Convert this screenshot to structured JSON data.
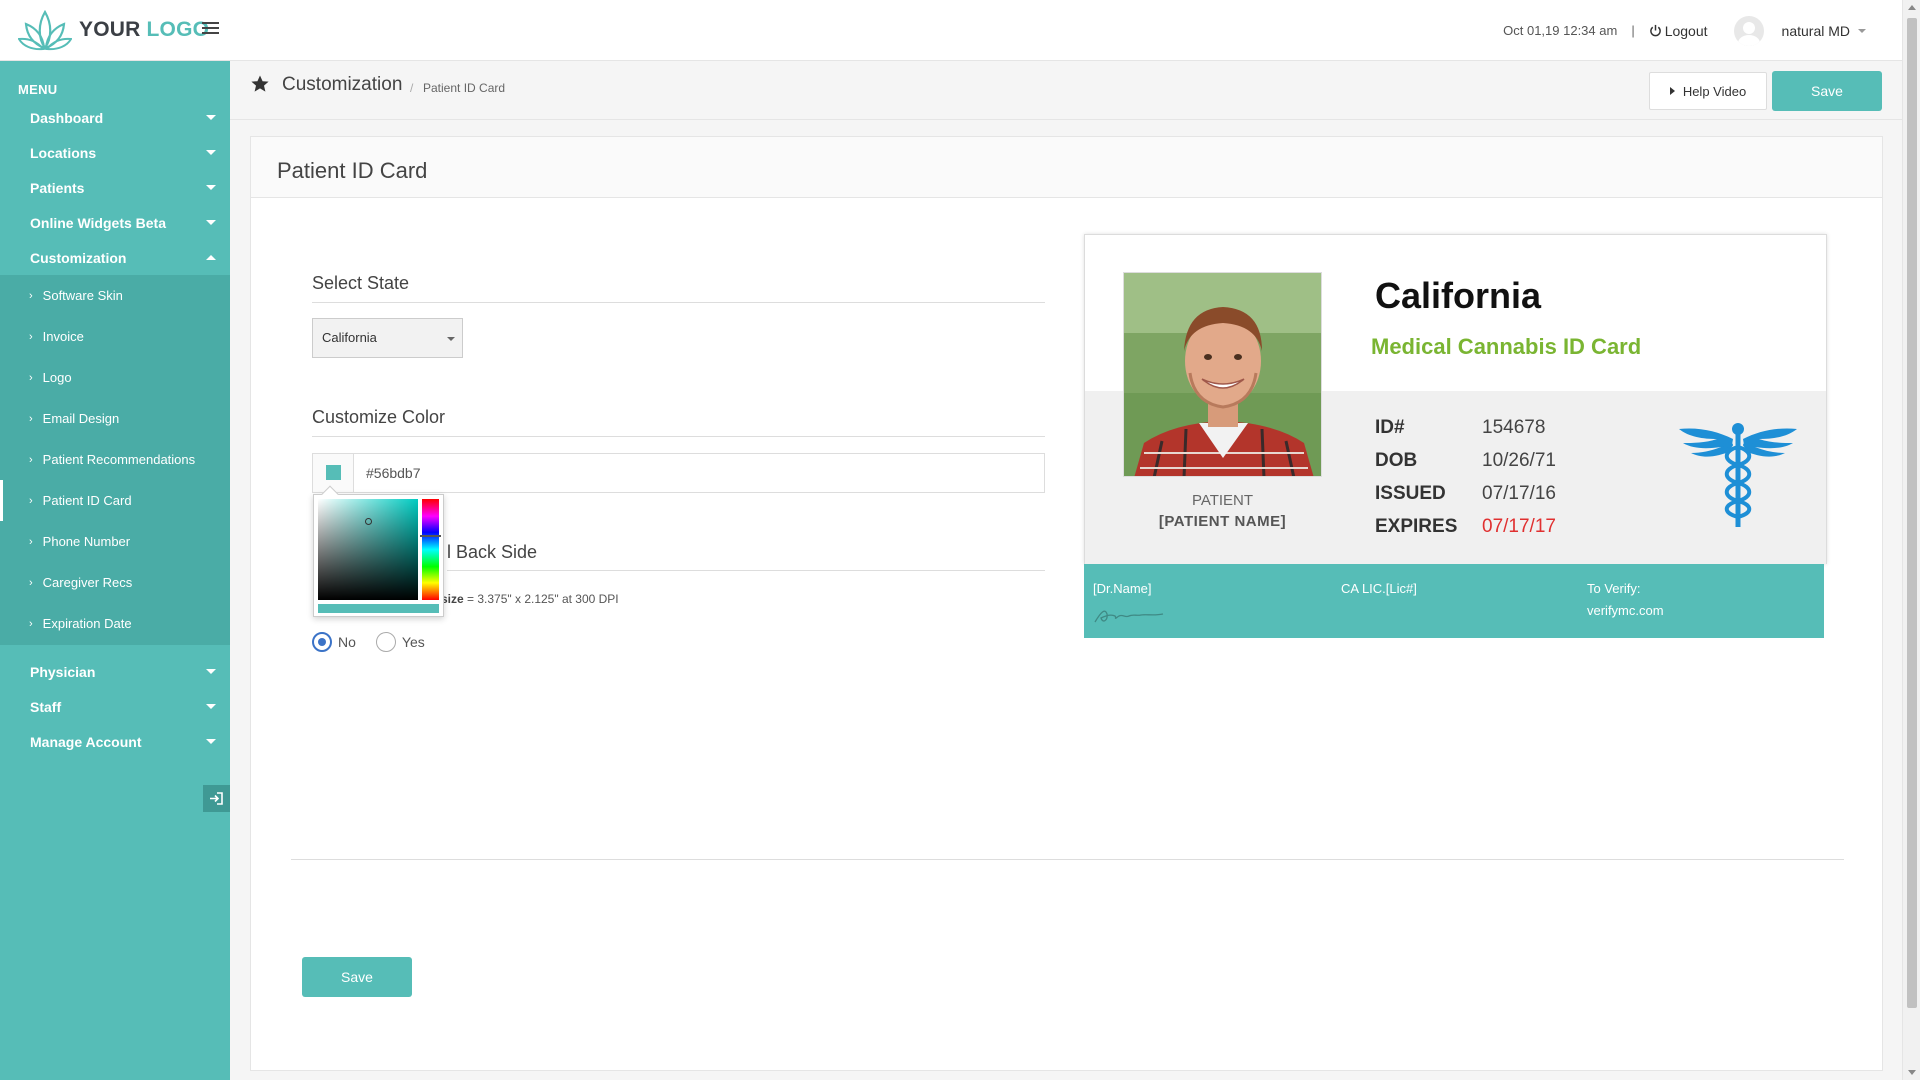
{
  "header": {
    "logo": {
      "word1": "YOUR",
      "word2": "LOGO"
    },
    "datetime": "Oct 01,19 12:34 am",
    "separator": "|",
    "logout_label": "Logout",
    "username": "natural MD"
  },
  "sidebar": {
    "menu_title": "MENU",
    "items": [
      {
        "label": "Dashboard"
      },
      {
        "label": "Locations"
      },
      {
        "label": "Patients"
      },
      {
        "label": "Online Widgets Beta"
      },
      {
        "label": "Customization",
        "expanded": true
      }
    ],
    "submenu": [
      {
        "label": "Software Skin"
      },
      {
        "label": "Invoice"
      },
      {
        "label": "Logo"
      },
      {
        "label": "Email Design"
      },
      {
        "label": "Patient Recommendations"
      },
      {
        "label": "Patient ID Card",
        "active": true
      },
      {
        "label": "Phone Number"
      },
      {
        "label": "Caregiver Recs"
      },
      {
        "label": "Expiration Date"
      }
    ],
    "items_after": [
      {
        "label": "Physician"
      },
      {
        "label": "Staff"
      },
      {
        "label": "Manage Account"
      }
    ]
  },
  "page": {
    "title": "Customization",
    "breadcrumb_sep": "/",
    "breadcrumb": "Patient ID Card",
    "help_label": "Help Video",
    "save_label": "Save"
  },
  "panel": {
    "title": "Patient ID Card",
    "select_state_label": "Select State",
    "state_value": "California",
    "customize_color_label": "Customize Color",
    "color_value": "#56bdb7",
    "back_side_label": "l Back Side",
    "size_prefix": "size",
    "size_text": " = 3.375\" x 2.125\" at 300 DPI",
    "radio_no": "No",
    "radio_yes": "Yes",
    "radio_selected": "No",
    "save_label": "Save"
  },
  "card": {
    "state": "California",
    "subtitle": "Medical Cannabis ID Card",
    "fields": [
      {
        "key": "ID#",
        "value": "154678"
      },
      {
        "key": "DOB",
        "value": "10/26/71"
      },
      {
        "key": "ISSUED",
        "value": "07/17/16"
      },
      {
        "key": "EXPIRES",
        "value": "07/17/17"
      }
    ],
    "patient_label": "PATIENT",
    "patient_name": "[PATIENT NAME]",
    "dr_name": "[Dr.Name]",
    "license": "CA LIC.[Lic#]",
    "verify_label": "To Verify:",
    "verify_url": "verifymc.com"
  },
  "colors": {
    "accent": "#56bdb7",
    "sidebar_sub": "#4aaca6",
    "card_subtitle": "#7ab532",
    "expires": "#e03030",
    "caduceus": "#1e8fd6",
    "radio": "#3b73c7"
  }
}
